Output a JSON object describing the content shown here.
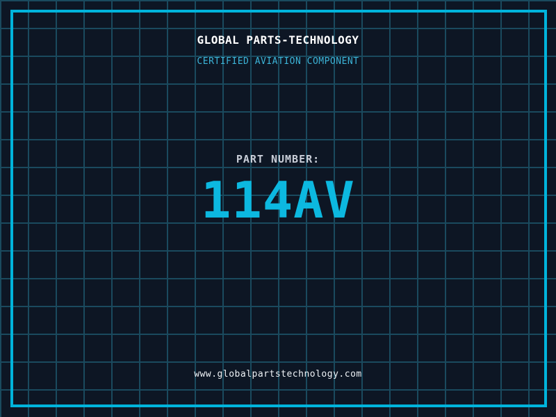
{
  "header": {
    "company_name": "GLOBAL PARTS-TECHNOLOGY",
    "tagline": "CERTIFIED AVIATION COMPONENT"
  },
  "part": {
    "label": "PART NUMBER:",
    "number": "114AV"
  },
  "footer": {
    "website": "www.globalpartstechnology.com"
  },
  "colors": {
    "background": "#0d1624",
    "grid_line": "#1a4a5e",
    "frame_border": "#00b4dc",
    "accent_cyan": "#0cb8e0",
    "tagline_cyan": "#3cb4d8",
    "title_white": "#ffffff",
    "label_gray": "#c9ced8"
  }
}
